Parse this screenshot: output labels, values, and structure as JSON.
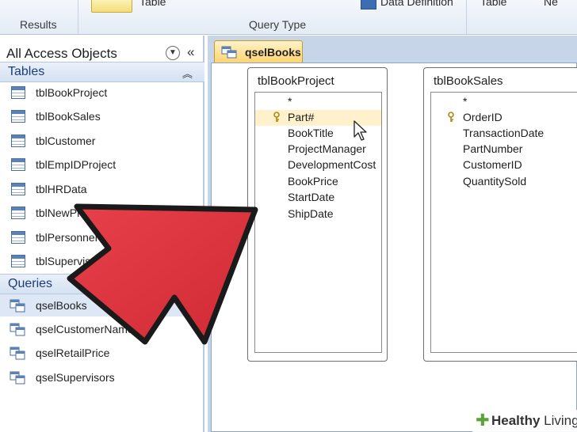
{
  "ribbon": {
    "group_results": "Results",
    "group_query_type": "Query Type",
    "cut_table": "Table",
    "cut_data_definition": "Data Definition",
    "cut_table_2": "Table",
    "cut_right": "Ne"
  },
  "nav": {
    "title": "All Access Objects",
    "groups": {
      "tables": "Tables",
      "queries": "Queries"
    },
    "tables": [
      {
        "label": "tblBookProject"
      },
      {
        "label": "tblBookSales"
      },
      {
        "label": "tblCustomer"
      },
      {
        "label": "tblEmpIDProject"
      },
      {
        "label": "tblHRData"
      },
      {
        "label": "tblNewProject"
      },
      {
        "label": "tblPersonnel"
      },
      {
        "label": "tblSupervisors"
      }
    ],
    "queries": [
      {
        "label": "qselBooks"
      },
      {
        "label": "qselCustomerNames"
      },
      {
        "label": "qselRetailPrice"
      },
      {
        "label": "qselSupervisors"
      }
    ]
  },
  "document": {
    "tab_label": "qselBooks",
    "tables": [
      {
        "title": "tblBookProject",
        "fields": [
          "*",
          "Part#",
          "BookTitle",
          "ProjectManager",
          "DevelopmentCost",
          "BookPrice",
          "StartDate",
          "ShipDate"
        ],
        "key_field": "Part#"
      },
      {
        "title": "tblBookSales",
        "fields": [
          "*",
          "OrderID",
          "TransactionDate",
          "PartNumber",
          "CustomerID",
          "QuantitySold"
        ],
        "key_field": "OrderID"
      }
    ]
  },
  "watermark": {
    "brand_a": "Healthy",
    "brand_b": "Living"
  },
  "colors": {
    "arrow": "#e0353f",
    "tab_accent": "#ffd46e",
    "selection": "#dde7f5"
  }
}
